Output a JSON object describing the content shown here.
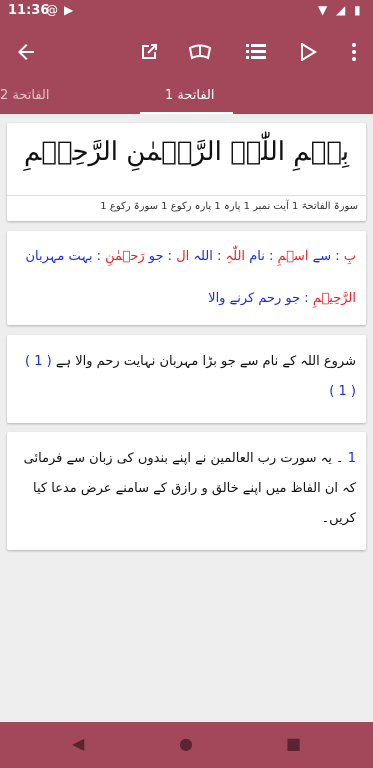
{
  "status": {
    "time": "11:36"
  },
  "icons": {
    "back": "arrow-back-icon",
    "share": "open-external-icon",
    "quran": "quran-book-icon",
    "list": "list-icon",
    "play": "play-icon",
    "more": "more-vertical-icon"
  },
  "tabs": [
    {
      "label": "الفاتحة 1",
      "active": true
    },
    {
      "label": "الفاتحة 2",
      "active": false
    }
  ],
  "verse": {
    "arabic": "بِسۡمِ اللّٰہِ الرَّحۡمٰنِ الرَّحِیۡمِ",
    "meta": "سورۃ الفاتحۃ 1  آیت نمبر 1  پارہ 1  پارہ رکوع 1  سورۃ رکوع 1"
  },
  "word_by_word": {
    "w1": "بِ",
    "m1": ": سے",
    "w2": "اسۡمِ",
    "m2": ": نام",
    "w3": "اللّٰہِ",
    "m3": ": اللہ",
    "w4": "ال",
    "m4": ": جو",
    "w5": "رَحۡمٰنِ",
    "m5": ": بہت مہربان",
    "w6": "الرَّحِیۡمِ",
    "m6": ": جو رحم کرنے والا"
  },
  "translation": {
    "text": "شروع اللہ کے نام سے جو بڑا مہربان نہایت رحم والا ہے",
    "ref": "( 1 )",
    "ref2": "( 1 )"
  },
  "tafsir": {
    "num": "1",
    "text": "۔ یہ سورت رب العالمین نے اپنے بندوں کی زبان سے فرمائی کہ ان الفاظ میں اپنے خالق و رازق کے سامنے عرض مدعا کیا کریں۔"
  },
  "colors": {
    "primary": "#a3485a",
    "red": "#e8242a",
    "blue": "#1a2ee0"
  }
}
